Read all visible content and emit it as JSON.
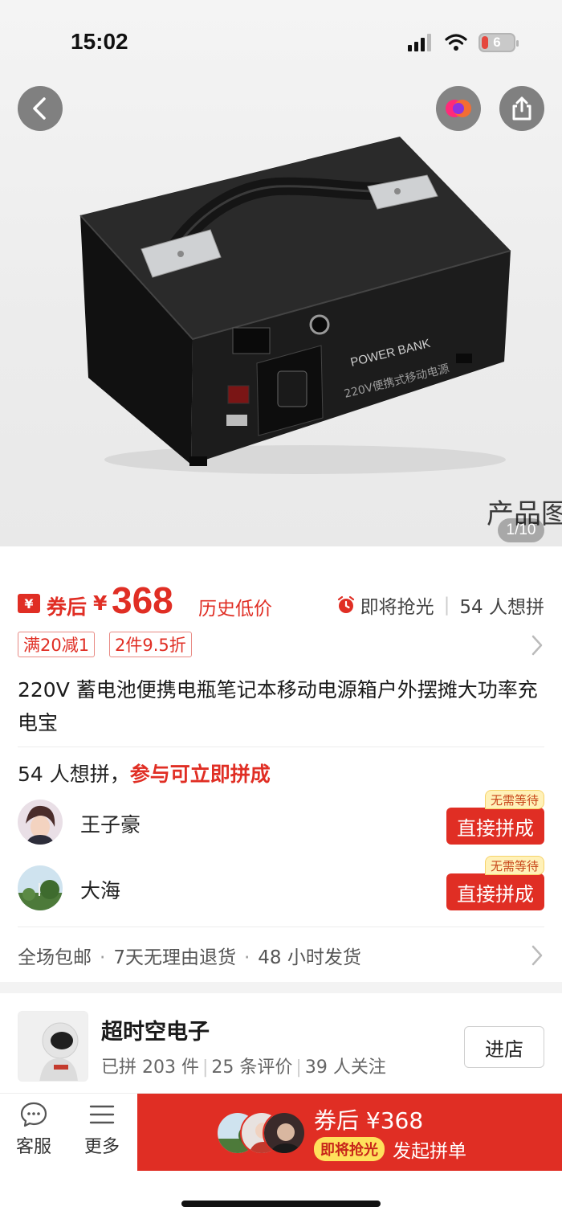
{
  "status_bar": {
    "time": "15:02",
    "battery": "6"
  },
  "gallery": {
    "caption": "产品图",
    "counter": "1/10"
  },
  "price": {
    "coupon_icon": "¥",
    "after_coupon": "券后",
    "currency": "¥",
    "amount": "368",
    "history_low": "历史低价",
    "sell_out": "即将抢光",
    "want_count": "54 人想拼"
  },
  "promos": {
    "tag1": "满20减1",
    "tag2": "2件9.5折"
  },
  "product": {
    "title": "220V 蓄电池便携电瓶笔记本移动电源箱户外摆摊大功率充电宝"
  },
  "group_buy": {
    "want_text": "54 人想拼，",
    "join_hint": "参与可立即拼成",
    "groups": [
      {
        "name": "王子豪",
        "badge": "无需等待",
        "button": "直接拼成"
      },
      {
        "name": "大海",
        "badge": "无需等待",
        "button": "直接拼成"
      }
    ]
  },
  "services": {
    "free_shipping": "全场包邮",
    "returns": "7天无理由退货",
    "dispatch": "48 小时发货"
  },
  "store": {
    "name": "超时空电子",
    "sold": "已拼 203 件",
    "reviews": "25 条评价",
    "followers": "39 人关注",
    "enter": "进店"
  },
  "bottom_bar": {
    "service_label": "客服",
    "more_label": "更多",
    "cta_price": "券后 ¥368",
    "cta_hot": "即将抢光",
    "cta_action": "发起拼单"
  },
  "colors": {
    "accent": "#e02e24",
    "badge_bg": "#fff1b8"
  },
  "icons": [
    "back-icon",
    "brand-icon",
    "share-icon",
    "clock-icon",
    "chevron-right-icon",
    "chat-icon",
    "menu-icon"
  ]
}
